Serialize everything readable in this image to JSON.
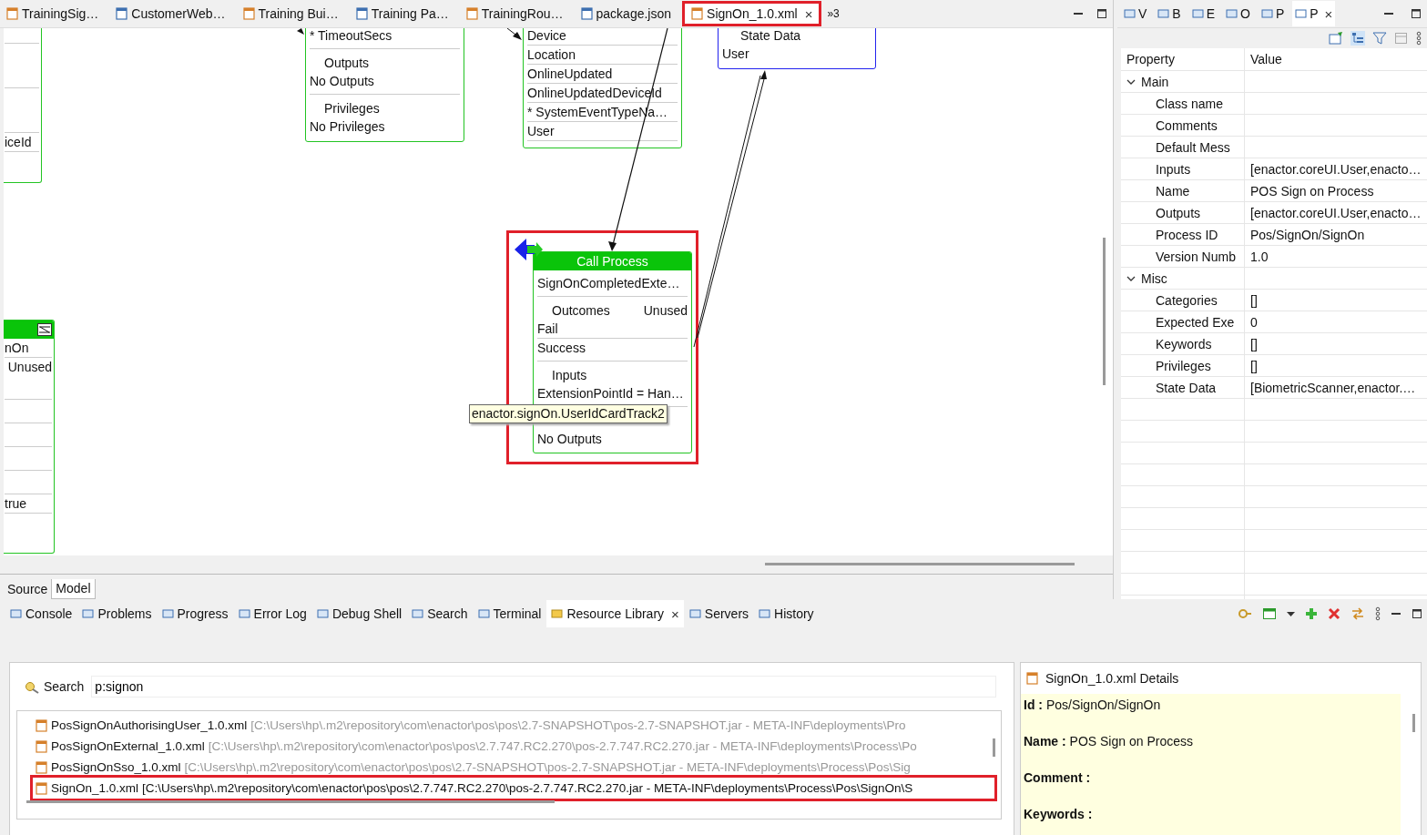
{
  "editor_tabs": [
    {
      "label": "TrainingSig…",
      "selected": false
    },
    {
      "label": "CustomerWeb…",
      "selected": false
    },
    {
      "label": "Training Bui…",
      "selected": false
    },
    {
      "label": "Training Pa…",
      "selected": false
    },
    {
      "label": "TrainingRou…",
      "selected": false
    },
    {
      "label": "package.json",
      "selected": false
    },
    {
      "label": "SignOn_1.0.xml",
      "selected": true,
      "close": "×"
    }
  ],
  "hidden_tabs": "»3",
  "canvas": {
    "nodes": [
      {
        "kind": "partial",
        "sections": [
          {
            "items": [
              "iceId"
            ]
          }
        ]
      },
      {
        "kind": "list",
        "sections": [
          {
            "items": [
              "* TimeoutSecs"
            ]
          },
          {
            "heading": "Outputs",
            "items": [
              "No Outputs"
            ]
          },
          {
            "heading": "Privileges",
            "items": [
              "No Privileges"
            ]
          }
        ]
      },
      {
        "kind": "rows",
        "sections": [
          {
            "items": [
              "Device",
              "Location",
              "OnlineUpdated",
              "OnlineUpdatedDeviceId",
              "* SystemEventTypeNa…",
              "User"
            ]
          }
        ]
      },
      {
        "kind": "state",
        "sections": [
          {
            "heading": "State Data",
            "items": [
              "User"
            ]
          }
        ]
      },
      {
        "kind": "call",
        "title": "Call Process",
        "sections": [
          {
            "items": [
              "SignOnCompletedExte…"
            ]
          },
          {
            "heading": "Outcomes",
            "note": "Unused",
            "items": [
              "Fail",
              "Success"
            ]
          },
          {
            "heading": "Inputs",
            "items": [
              "ExtensionPointId = Han…"
            ]
          },
          {
            "items": [
              "No Outputs"
            ]
          }
        ]
      },
      {
        "kind": "partial_titled",
        "sections": [
          {
            "items": [
              "nOn"
            ]
          },
          {
            "note": "Unused",
            "items": [
              "true"
            ]
          }
        ]
      }
    ],
    "tooltip": "enactor.signOn.UserIdCardTrack2"
  },
  "editor_mode_tabs": [
    {
      "label": "Source",
      "selected": false
    },
    {
      "label": "Model",
      "selected": true
    }
  ],
  "side_tabs": [
    {
      "label": "V",
      "selected": false
    },
    {
      "label": "B",
      "selected": false
    },
    {
      "label": "E",
      "selected": false
    },
    {
      "label": "O",
      "selected": false
    },
    {
      "label": "P",
      "selected": false
    },
    {
      "label": "P",
      "selected": true,
      "close": "×"
    }
  ],
  "properties": {
    "columns": [
      "Property",
      "Value"
    ],
    "groups": [
      {
        "name": "Main",
        "expanded": true,
        "rows": [
          {
            "property": "Class name"
          },
          {
            "property": "Comments"
          },
          {
            "property": "Default Mess"
          },
          {
            "property": "Inputs",
            "value": "[enactor.coreUI.User,enacto…"
          },
          {
            "property": "Name",
            "value": "POS Sign on Process"
          },
          {
            "property": "Outputs",
            "value": "[enactor.coreUI.User,enacto…"
          },
          {
            "property": "Process ID",
            "value": "Pos/SignOn/SignOn"
          },
          {
            "property": "Version Numb",
            "value": "1.0"
          }
        ]
      },
      {
        "name": "Misc",
        "expanded": true,
        "rows": [
          {
            "property": "Categories",
            "value": "[]"
          },
          {
            "property": "Expected Exe",
            "value": "0"
          },
          {
            "property": "Keywords",
            "value": "[]"
          },
          {
            "property": "Privileges",
            "value": "[]"
          },
          {
            "property": "State Data",
            "value": "[BiometricScanner,enactor.…"
          }
        ]
      }
    ]
  },
  "bottom_tabs": [
    {
      "label": "Console",
      "selected": false
    },
    {
      "label": "Problems",
      "selected": false
    },
    {
      "label": "Progress",
      "selected": false
    },
    {
      "label": "Error Log",
      "selected": false
    },
    {
      "label": "Debug Shell",
      "selected": false
    },
    {
      "label": "Search",
      "selected": false
    },
    {
      "label": "Terminal",
      "selected": false
    },
    {
      "label": "Resource Library",
      "selected": true,
      "close": "×"
    },
    {
      "label": "Servers",
      "selected": false
    },
    {
      "label": "History",
      "selected": false
    }
  ],
  "search": {
    "label": "Search",
    "value": "p:signon"
  },
  "results": [
    {
      "name": "PosSignOnAuthorisingUser_1.0.xml",
      "path": "[C:\\Users\\hp\\.m2\\repository\\com\\enactor\\pos\\pos\\2.7-SNAPSHOT\\pos-2.7-SNAPSHOT.jar - META-INF\\deployments\\Pro",
      "selected": false
    },
    {
      "name": "PosSignOnExternal_1.0.xml",
      "path": "[C:\\Users\\hp\\.m2\\repository\\com\\enactor\\pos\\pos\\2.7.747.RC2.270\\pos-2.7.747.RC2.270.jar - META-INF\\deployments\\Process\\Po",
      "selected": false
    },
    {
      "name": "PosSignOnSso_1.0.xml",
      "path": "[C:\\Users\\hp\\.m2\\repository\\com\\enactor\\pos\\pos\\2.7-SNAPSHOT\\pos-2.7-SNAPSHOT.jar - META-INF\\deployments\\Process\\Pos\\Sig",
      "selected": false
    },
    {
      "name": "SignOn_1.0.xml",
      "path": "[C:\\Users\\hp\\.m2\\repository\\com\\enactor\\pos\\pos\\2.7.747.RC2.270\\pos-2.7.747.RC2.270.jar - META-INF\\deployments\\Process\\Pos\\SignOn\\S",
      "selected": true
    }
  ],
  "details": {
    "title": "SignOn_1.0.xml Details",
    "fields": [
      {
        "label": "Id :",
        "value": "Pos/SignOn/SignOn"
      },
      {
        "label": "Name :",
        "value": "POS Sign on Process"
      },
      {
        "label": "Comment :"
      },
      {
        "label": "Keywords :"
      }
    ]
  }
}
